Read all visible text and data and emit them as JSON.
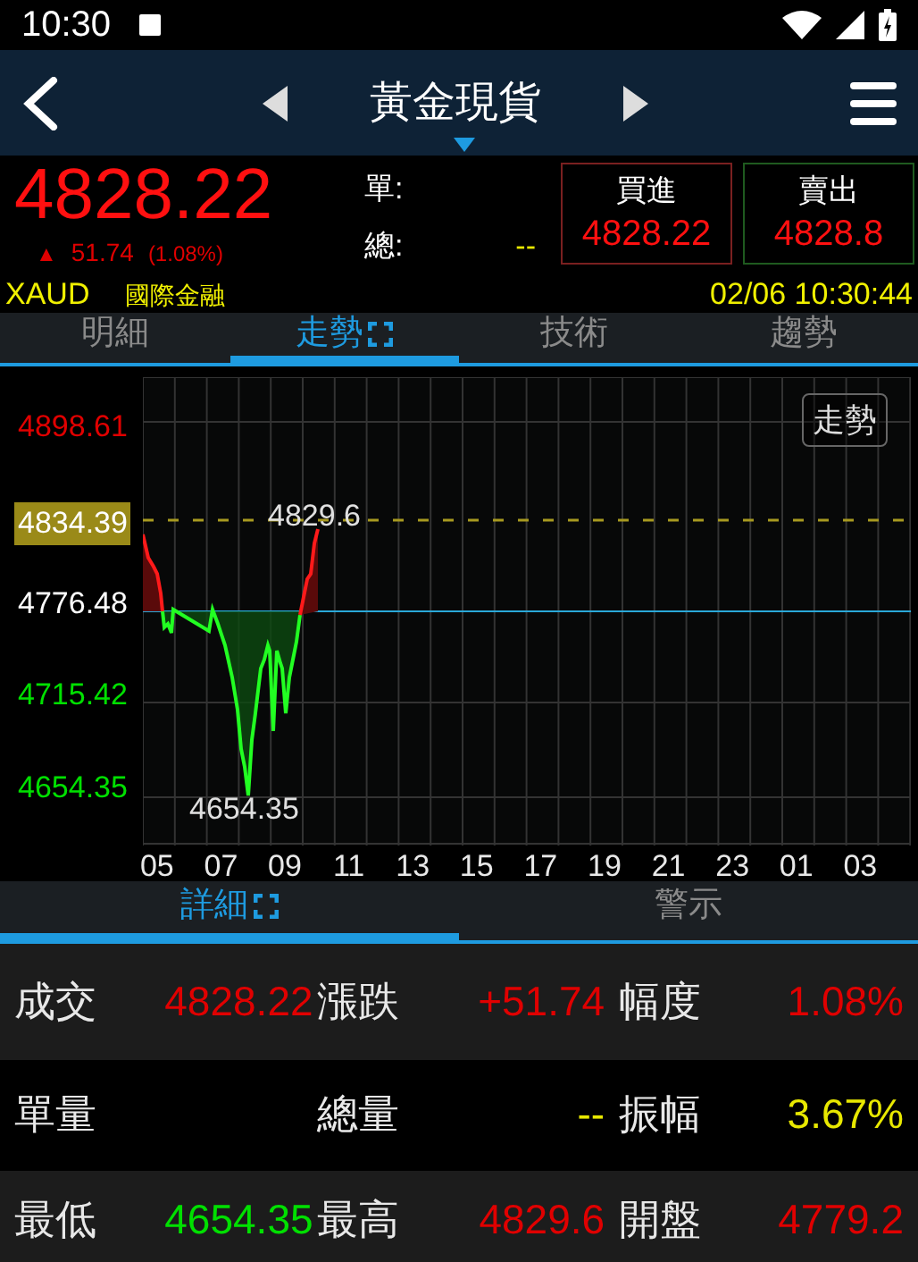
{
  "status_bar": {
    "time": "10:30"
  },
  "header": {
    "title": "黃金現貨"
  },
  "quote": {
    "price": "4828.22",
    "arrow": "▲",
    "change": "51.74",
    "change_pct": "(1.08%)",
    "unit_label": "單:",
    "total_label": "總:",
    "total_value": "--",
    "buy": {
      "label": "買進",
      "value": "4828.22"
    },
    "sell": {
      "label": "賣出",
      "value": "4828.8"
    },
    "symbol": "XAUD",
    "source": "國際金融",
    "datetime": "02/06 10:30:44"
  },
  "tabs": [
    {
      "label": "明細",
      "selected": false,
      "fullscreen_icon": false
    },
    {
      "label": "走勢",
      "selected": true,
      "fullscreen_icon": true
    },
    {
      "label": "技術",
      "selected": false,
      "fullscreen_icon": false
    },
    {
      "label": "趨勢",
      "selected": false,
      "fullscreen_icon": false
    }
  ],
  "chart": {
    "mode_button": "走勢",
    "reference_badge": "4834.39",
    "high_label": "4829.6",
    "low_label": "4654.35",
    "y_labels": [
      {
        "text": "4898.61",
        "color": "#e00000"
      },
      {
        "text": "4776.48",
        "color": "#ffffff"
      },
      {
        "text": "4715.42",
        "color": "#00e000"
      },
      {
        "text": "4654.35",
        "color": "#00e000"
      }
    ],
    "x_labels": [
      "05",
      "07",
      "09",
      "11",
      "13",
      "15",
      "17",
      "19",
      "21",
      "23",
      "01",
      "03"
    ]
  },
  "detail_tabs": [
    {
      "label": "詳細",
      "selected": true,
      "fullscreen_icon": true
    },
    {
      "label": "警示",
      "selected": false,
      "fullscreen_icon": false
    }
  ],
  "details": [
    [
      {
        "label": "成交",
        "value": "4828.22",
        "color": "#e00000"
      },
      {
        "label": "漲跌",
        "value": "+51.74",
        "color": "#e00000"
      },
      {
        "label": "幅度",
        "value": "1.08%",
        "color": "#e00000"
      }
    ],
    [
      {
        "label": "單量"
      },
      {
        "label": "總量",
        "value": "--",
        "color": "#e8e800"
      },
      {
        "label": "振幅",
        "value": "3.67%",
        "color": "#e8e800"
      }
    ],
    [
      {
        "label": "最低",
        "value": "4654.35",
        "color": "#00e000"
      },
      {
        "label": "最高",
        "value": "4829.6",
        "color": "#e00000"
      },
      {
        "label": "開盤",
        "value": "4779.2",
        "color": "#e00000"
      }
    ]
  ]
}
